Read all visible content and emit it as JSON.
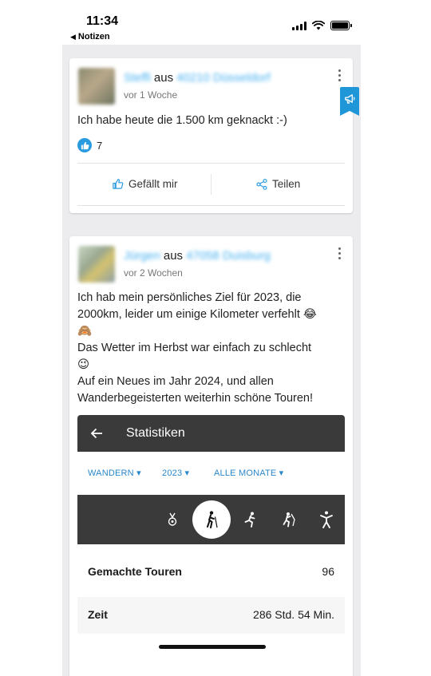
{
  "status_bar": {
    "time": "11:34",
    "back_label": "Notizen"
  },
  "posts": [
    {
      "author": "Steffi",
      "connector": "aus",
      "location": "40210 Düsseldorf",
      "time_ago": "vor 1 Woche",
      "text": "Ich habe heute die 1.500 km geknackt :-)",
      "likes": "7",
      "like_label": "Gefällt mir",
      "share_label": "Teilen"
    },
    {
      "author": "Jürgen",
      "connector": "aus",
      "location": "47058 Duisburg",
      "time_ago": "vor 2 Wochen",
      "lines": [
        "Ich hab mein persönliches Ziel für 2023, die",
        "2000km, leider um einige Kilometer verfehlt 😂",
        "🙈",
        "Das Wetter im Herbst war einfach zu schlecht",
        "😉",
        "Auf ein Neues im Jahr 2024, und allen",
        "Wanderbegeisterten weiterhin schöne Touren!"
      ]
    }
  ],
  "stats_screenshot": {
    "title": "Statistiken",
    "filters": [
      "WANDERN ▾",
      "2023 ▾",
      "ALLE MONATE ▾"
    ],
    "activities": [
      "medal-icon",
      "hiking-icon",
      "running-icon",
      "climbing-icon",
      "yoga-icon"
    ],
    "selected_activity": "hiking-icon",
    "rows": [
      {
        "label": "Gemachte Touren",
        "value": "96"
      },
      {
        "label": "Zeit",
        "value": "286 Std. 54 Min."
      }
    ]
  },
  "colors": {
    "accent": "#2b9be0",
    "feed_background": "#ececef",
    "stats_dark": "#3a3a3a"
  }
}
